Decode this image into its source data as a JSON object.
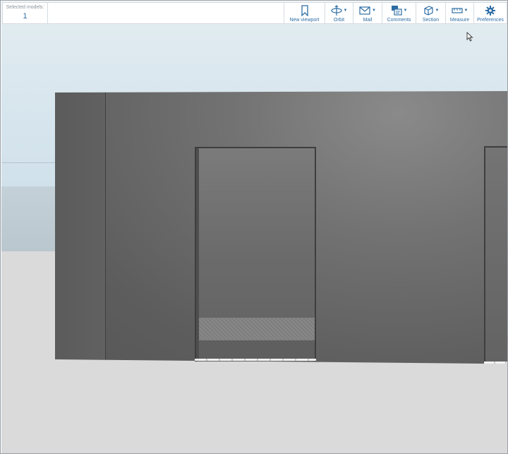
{
  "toolbar": {
    "selected_models_label": "Selected models:",
    "selected_models_count": "1",
    "buttons": [
      {
        "label": "New viewport",
        "icon": "bookmark-icon"
      },
      {
        "label": "Orbit",
        "icon": "orbit-icon"
      },
      {
        "label": "Mail",
        "icon": "mail-icon"
      },
      {
        "label": "Comments",
        "icon": "comments-icon"
      },
      {
        "label": "Section",
        "icon": "section-box-icon"
      },
      {
        "label": "Measure",
        "icon": "measure-icon"
      },
      {
        "label": "Preferences",
        "icon": "gear-icon"
      }
    ]
  },
  "colors": {
    "accent": "#2d6da4",
    "wall": "#6f6f6f",
    "sky": "#d8e6ee",
    "ground": "#dadada"
  }
}
